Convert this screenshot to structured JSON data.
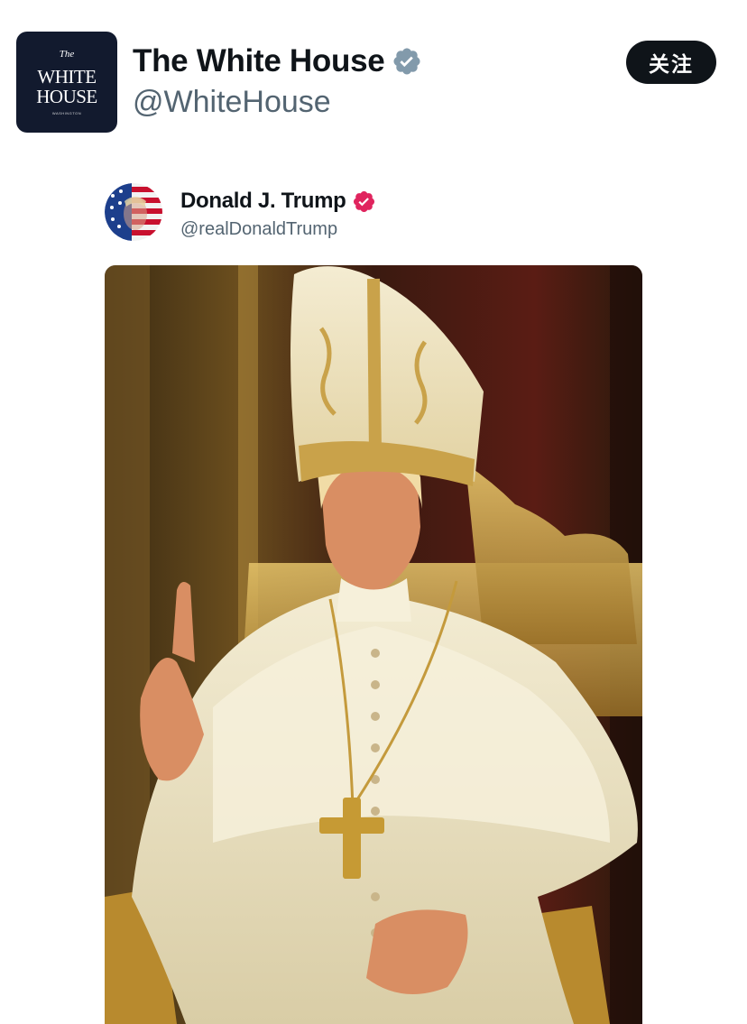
{
  "account": {
    "logo_text": {
      "the": "The",
      "line1": "WHITE",
      "line2": "HOUSE",
      "line3": "WASHINGTON"
    },
    "name": "The White House",
    "handle": "@WhiteHouse",
    "verified_icon": "verified-badge-gray"
  },
  "follow_button": {
    "label": "关注"
  },
  "quoted_post": {
    "name": "Donald J. Trump",
    "handle": "@realDonaldTrump",
    "verified_icon": "verified-badge-pink",
    "avatar_icon": "flag-portrait-avatar",
    "media": "image of man in white papal vestments and gold mitre seated on gilded throne, raising index finger"
  },
  "colors": {
    "text_primary": "#0f1419",
    "text_secondary": "#536471",
    "follow_bg": "#0f1419",
    "logo_bg": "#121a2e",
    "verified_gray": "#829aab",
    "verified_pink": "#e0245e"
  }
}
